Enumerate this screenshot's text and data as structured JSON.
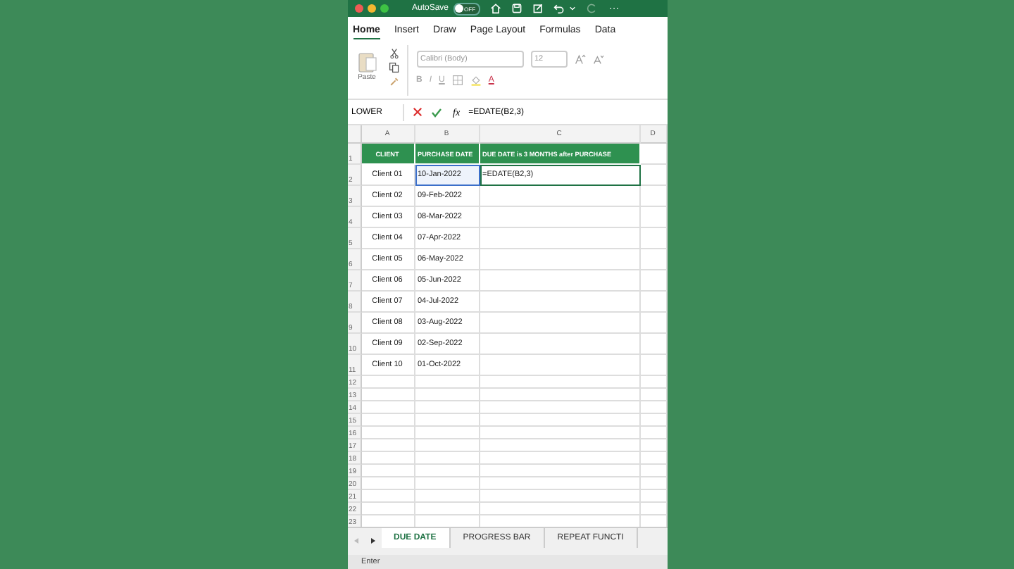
{
  "title_bar": {
    "autosave_label": "AutoSave",
    "autosave_on": false,
    "toggle_text": "OFF",
    "more": "···"
  },
  "ribbon_tabs": [
    {
      "label": "Home",
      "selected": true
    },
    {
      "label": "Insert",
      "selected": false
    },
    {
      "label": "Draw",
      "selected": false
    },
    {
      "label": "Page Layout",
      "selected": false
    },
    {
      "label": "Formulas",
      "selected": false
    },
    {
      "label": "Data",
      "selected": false
    }
  ],
  "ribbon": {
    "paste_label": "Paste",
    "font_name": "Calibri (Body)",
    "font_size": "12",
    "bold": "B",
    "italic": "I",
    "underline": "U",
    "font_color": "A"
  },
  "formula_bar": {
    "name_box": "LOWER",
    "fx": "fx",
    "formula": "=EDATE(B2,3)"
  },
  "columns": [
    "A",
    "B",
    "C",
    "D"
  ],
  "rows": [
    {
      "number": "1",
      "header": true,
      "editing": false,
      "cells": [
        "CLIENT",
        "PURCHASE DATE",
        "DUE DATE is 3 MONTHS after PURCHASE"
      ]
    },
    {
      "number": "2",
      "header": false,
      "editing": true,
      "cells": [
        "Client 01",
        "10-Jan-2022",
        "=EDATE(B2,3)"
      ]
    },
    {
      "number": "3",
      "header": false,
      "editing": false,
      "cells": [
        "Client 02",
        "09-Feb-2022",
        ""
      ]
    },
    {
      "number": "4",
      "header": false,
      "editing": false,
      "cells": [
        "Client 03",
        "08-Mar-2022",
        ""
      ]
    },
    {
      "number": "5",
      "header": false,
      "editing": false,
      "cells": [
        "Client 04",
        "07-Apr-2022",
        ""
      ]
    },
    {
      "number": "6",
      "header": false,
      "editing": false,
      "cells": [
        "Client 05",
        "06-May-2022",
        ""
      ]
    },
    {
      "number": "7",
      "header": false,
      "editing": false,
      "cells": [
        "Client 06",
        "05-Jun-2022",
        ""
      ]
    },
    {
      "number": "8",
      "header": false,
      "editing": false,
      "cells": [
        "Client 07",
        "04-Jul-2022",
        ""
      ]
    },
    {
      "number": "9",
      "header": false,
      "editing": false,
      "cells": [
        "Client 08",
        "03-Aug-2022",
        ""
      ]
    },
    {
      "number": "10",
      "header": false,
      "editing": false,
      "cells": [
        "Client 09",
        "02-Sep-2022",
        ""
      ]
    },
    {
      "number": "11",
      "header": false,
      "editing": false,
      "cells": [
        "Client 10",
        "01-Oct-2022",
        ""
      ]
    }
  ],
  "empty_rows": [
    "12",
    "13",
    "14",
    "15",
    "16",
    "17",
    "18",
    "19",
    "20",
    "21",
    "22",
    "23"
  ],
  "sheet_tabs": [
    {
      "label": "DUE DATE",
      "selected": true
    },
    {
      "label": "PROGRESS BAR",
      "selected": false
    },
    {
      "label": "REPEAT FUNCTI",
      "selected": false
    }
  ],
  "status_bar": "Enter"
}
